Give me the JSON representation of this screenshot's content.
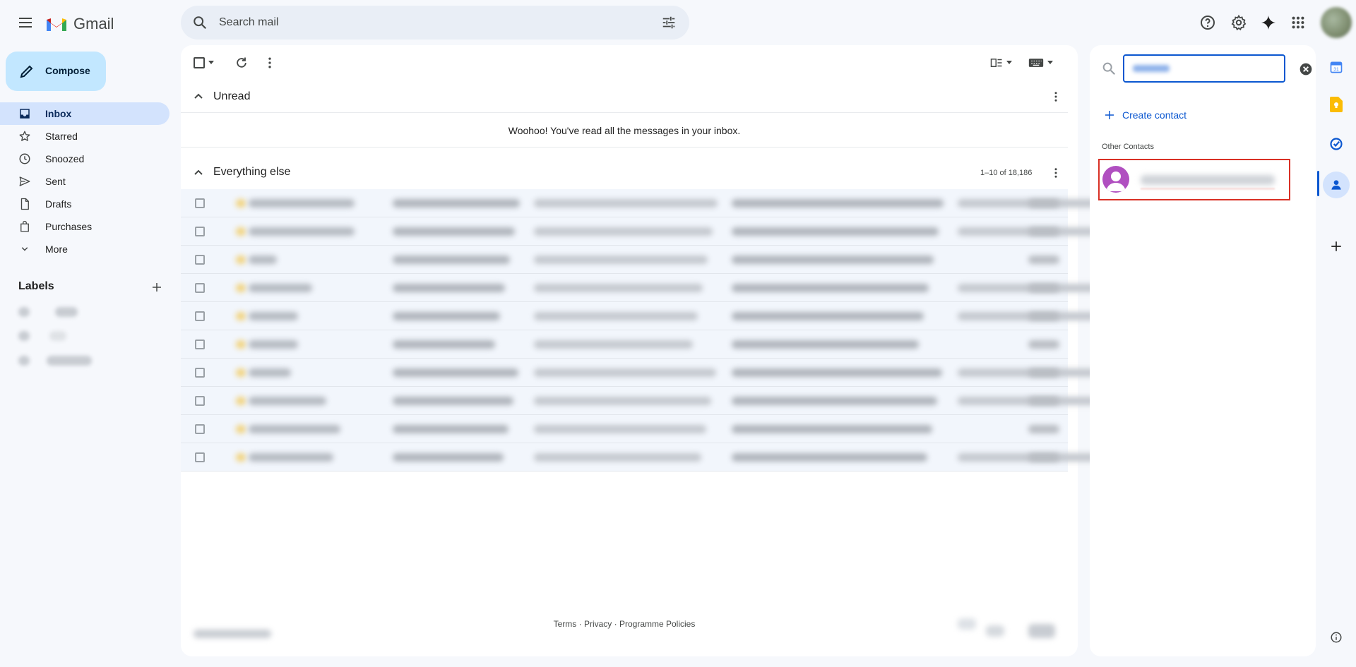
{
  "app": {
    "name": "Gmail"
  },
  "search": {
    "placeholder": "Search mail"
  },
  "compose": {
    "label": "Compose"
  },
  "nav": {
    "items": [
      {
        "label": "Inbox",
        "icon": "inbox-icon",
        "active": true
      },
      {
        "label": "Starred",
        "icon": "star-icon"
      },
      {
        "label": "Snoozed",
        "icon": "clock-icon"
      },
      {
        "label": "Sent",
        "icon": "send-icon"
      },
      {
        "label": "Drafts",
        "icon": "draft-icon"
      },
      {
        "label": "Purchases",
        "icon": "bag-icon"
      },
      {
        "label": "More",
        "icon": "chevron-down-icon"
      }
    ]
  },
  "labels": {
    "title": "Labels"
  },
  "sections": {
    "unread": {
      "title": "Unread",
      "empty_message": "Woohoo! You've read all the messages in your inbox."
    },
    "everything_else": {
      "title": "Everything else",
      "count": "1–10 of 18,186"
    }
  },
  "mail_rows_count": 10,
  "footer": {
    "links": "Terms · Privacy · Programme Policies"
  },
  "contacts": {
    "create_label": "Create contact",
    "other_title": "Other Contacts",
    "avatar_color": "#b04fc0"
  },
  "colors": {
    "accent": "#0b57d0",
    "highlight": "#d93025",
    "compose_bg": "#c2e7ff",
    "active_nav": "#d3e3fd"
  }
}
